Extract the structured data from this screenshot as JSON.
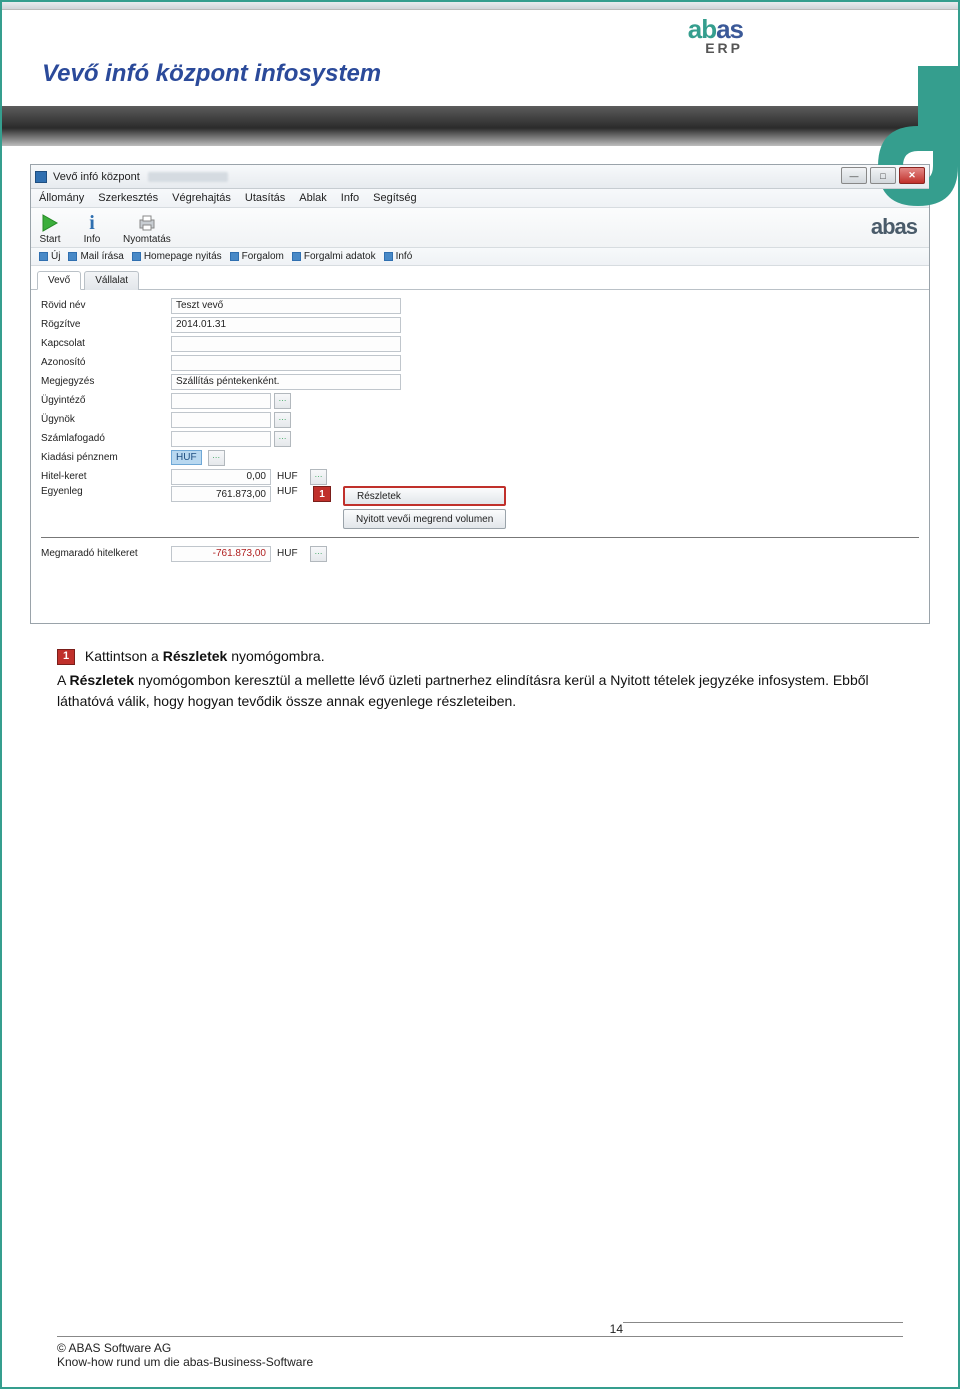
{
  "page": {
    "title": "Vevő infó központ infosystem",
    "page_number": "14"
  },
  "erp_logo": {
    "text": "abas",
    "sub": "ERP"
  },
  "app": {
    "window_title": "Vevő infó központ",
    "menus": [
      "Állomány",
      "Szerkesztés",
      "Végrehajtás",
      "Utasítás",
      "Ablak",
      "Info",
      "Segítség"
    ],
    "toolbar": {
      "start": "Start",
      "info": "Info",
      "print": "Nyomtatás",
      "logo": "abas"
    },
    "quickbar": [
      "Új",
      "Mail írása",
      "Homepage nyitás",
      "Forgalom",
      "Forgalmi adatok",
      "Infó"
    ],
    "tabs": {
      "active": "Vevő",
      "other": "Vállalat"
    },
    "fields": {
      "rovid_nev": {
        "label": "Rövid név",
        "value": "Teszt vevő"
      },
      "rogzitve": {
        "label": "Rögzítve",
        "value": "2014.01.31"
      },
      "kapcsolat": {
        "label": "Kapcsolat",
        "value": ""
      },
      "azonosito": {
        "label": "Azonosító",
        "value": ""
      },
      "megjegyzes": {
        "label": "Megjegyzés",
        "value": "Szállítás péntekenként."
      },
      "ugyintezo": {
        "label": "Ügyintéző",
        "value": ""
      },
      "ugynok": {
        "label": "Ügynök",
        "value": ""
      },
      "szamlafogado": {
        "label": "Számlafogadó",
        "value": ""
      },
      "penznem": {
        "label": "Kiadási pénznem",
        "value": "HUF"
      },
      "hitel": {
        "label": "Hitel-keret",
        "value": "0,00",
        "currency": "HUF"
      },
      "egyenleg": {
        "label": "Egyenleg",
        "value": "761.873,00",
        "currency": "HUF"
      },
      "megmarado": {
        "label": "Megmaradó hitelkeret",
        "value": "-761.873,00",
        "currency": "HUF"
      }
    },
    "callout": "1",
    "buttons": {
      "reszletek": "Részletek",
      "nyitott": "Nyitott vevői megrend volumen"
    }
  },
  "body": {
    "line1_prefix": "Kattintson a ",
    "line1_bold": "Részletek",
    "line1_suffix": " nyomógombra.",
    "para_1": "A ",
    "para_bold1": "Részletek",
    "para_2": " nyomógombon keresztül a mellette lévő üzleti partnerhez elindításra kerül a Nyitott tételek jegyzéke infosystem. Ebből láthatóvá válik, hogy hogyan tevődik össze annak egyenlege részleteiben."
  },
  "footer": {
    "copyright": "© ABAS Software AG",
    "tagline": "Know-how rund um die abas-Business-Software"
  }
}
